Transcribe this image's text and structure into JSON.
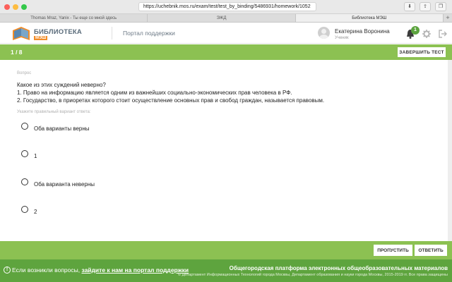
{
  "browser": {
    "url": "https://uchebnik.mos.ru/exam/test/test_by_binding/5486931/homework/1052",
    "tabs": [
      "Thomas Mraz, Yanix - Ты еще со мной здесь",
      "ЭЖД",
      "Библиотека МЭШ"
    ]
  },
  "header": {
    "logo_title": "БИБЛИОТЕКА",
    "logo_sub": "МЭШ",
    "support": "Портал поддержки",
    "user_name": "Екатерина Воронина",
    "user_role": "Ученик",
    "notifications": "1"
  },
  "progress": {
    "counter": "1 / 8",
    "finish": "ЗАВЕРШИТЬ ТЕСТ"
  },
  "question": {
    "label": "Вопрос",
    "lines": [
      "Какое из этих суждений неверно?",
      "1. Право на информацию является одним из важнейших социально-экономических прав человека в РФ.",
      "2. Государство, в приоретах которого стоит осуществление основных прав и свобод граждан, называется правовым."
    ],
    "hint": "Укажите правильный вариант ответа:",
    "options": [
      "Оба варианты верны",
      "1",
      "Оба варианта неверны",
      "2"
    ]
  },
  "actions": {
    "skip": "ПРОПУСТИТЬ",
    "answer": "ОТВЕТИТЬ"
  },
  "footer": {
    "help_prefix": "Если возникли вопросы, ",
    "help_link": "зайдите к нам на портал поддержки",
    "platform": "Общегородская платформа электронных общеобразовательных материалов",
    "copyright": "© Департамент Информационных Технологий города Москвы, Департамент образования и науки города Москвы, 2015-2019 гг. Все права защищены"
  },
  "colors": {
    "accent_green": "#8cc152",
    "footer_green": "#5ea43e",
    "logo_orange": "#f28c28"
  }
}
